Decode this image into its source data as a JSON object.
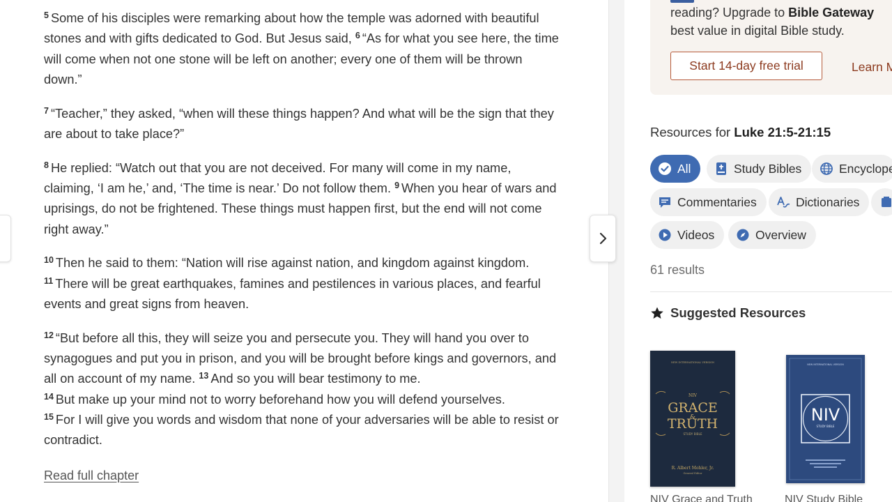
{
  "passage": {
    "verses": [
      {
        "runs": [
          {
            "num": "5",
            "text": "Some of his disciples were remarking about how the temple was adorned with beautiful stones and with gifts dedicated to God. But Jesus said, "
          },
          {
            "num": "6",
            "text": "“As for what you see here, the time will come when not one stone will be left on another; every one of them will be thrown down.”"
          }
        ]
      },
      {
        "runs": [
          {
            "num": "7",
            "text": "“Teacher,” they asked, “when will these things happen? And what will be the sign that they are about to take place?”"
          }
        ]
      },
      {
        "runs": [
          {
            "num": "8",
            "text": "He replied: “Watch out that you are not deceived. For many will come in my name, claiming, ‘I am he,’ and, ‘The time is near.’ Do not follow them. "
          },
          {
            "num": "9",
            "text": "When you hear of wars and uprisings, do not be frightened. These things must happen first, but the end will not come right away.”"
          }
        ]
      },
      {
        "runs": [
          {
            "num": "10",
            "text": "Then he said to them: “Nation will rise against nation, and kingdom against kingdom. "
          },
          {
            "num": "11",
            "text": "There will be great earthquakes, famines and pestilences in various places, and fearful events and great signs from heaven."
          }
        ]
      },
      {
        "runs": [
          {
            "num": "12",
            "text": "“But before all this, they will seize you and persecute you. They will hand you over to synagogues and put you in prison, and you will be brought before kings and governors, and all on account of my name. "
          },
          {
            "num": "13",
            "text": "And so you will bear testimony to me. "
          },
          {
            "num": "14",
            "text": "But make up your mind not to worry beforehand how you will defend yourselves. "
          },
          {
            "num": "15",
            "text": "For I will give you words and wisdom that none of your adversaries will be able to resist or contradict."
          }
        ]
      }
    ],
    "read_full_label": "Read full chapter"
  },
  "promo": {
    "line1_prefix": "reading? Upgrade to ",
    "line1_bold": "Bible Gateway",
    "line2": "best value in digital Bible study.",
    "trial_button": "Start 14-day free trial",
    "learn_more": "Learn M"
  },
  "resources": {
    "title_prefix": "Resources for ",
    "title_ref": "Luke 21:5-21:15",
    "filters": {
      "all": "All",
      "study_bibles": "Study Bibles",
      "encyclopedias": "Encyclope",
      "commentaries": "Commentaries",
      "dictionaries": "Dictionaries",
      "videos": "Videos",
      "overview": "Overview"
    },
    "results_count": "61 results",
    "suggested_title": "Suggested Resources",
    "books": [
      {
        "caption": "NIV Grace and Truth",
        "cover_top": "NEW INTERNATIONAL VERSION",
        "cover_niv": "NIV",
        "cover_title1": "GRACE",
        "cover_amp": "&",
        "cover_title2": "TRUTH",
        "cover_sub": "STUDY BIBLE",
        "cover_author": "R. Albert Mohler, Jr.",
        "cover_author_role": "General Editor"
      },
      {
        "caption": "NIV Study Bible",
        "cover_top": "NEW INTERNATIONAL VERSION",
        "cover_niv": "NIV",
        "cover_sub": "STUDY BIBLE"
      }
    ]
  },
  "colors": {
    "accent_blue": "#3f6bb2",
    "brand_rust": "#8c3a1e",
    "promo_bg": "#f7f3ef",
    "chip_bg": "#f0f0f0"
  },
  "icons": [
    "chevron-right-icon",
    "check-circle-icon",
    "study-bible-icon",
    "globe-icon",
    "comment-icon",
    "dictionary-icon",
    "play-icon",
    "compass-icon",
    "star-icon"
  ]
}
